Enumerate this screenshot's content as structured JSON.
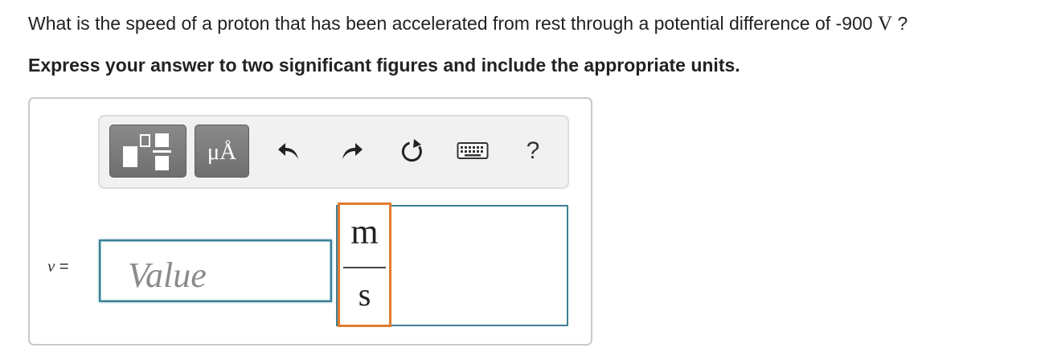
{
  "question": {
    "text_before_unit": "What is the speed of a proton that has been accelerated from rest through a potential difference of -900 ",
    "unit": "V",
    "text_after_unit": " ?"
  },
  "instruction": "Express your answer to two significant figures and include the appropriate units.",
  "toolbar": {
    "templates_icon": "templates-icon",
    "units_label": "μÅ",
    "undo_icon": "undo-icon",
    "redo_icon": "redo-icon",
    "reset_icon": "reset-icon",
    "keyboard_icon": "keyboard-icon",
    "help_label": "?"
  },
  "answer": {
    "variable": "v",
    "equals": "=",
    "value_placeholder": "Value",
    "unit_numerator": "m",
    "unit_denominator": "s"
  },
  "colors": {
    "input_border": "#3f7f94",
    "unit_highlight": "#e07b2f",
    "toolbar_button": "#7a7a7a"
  }
}
